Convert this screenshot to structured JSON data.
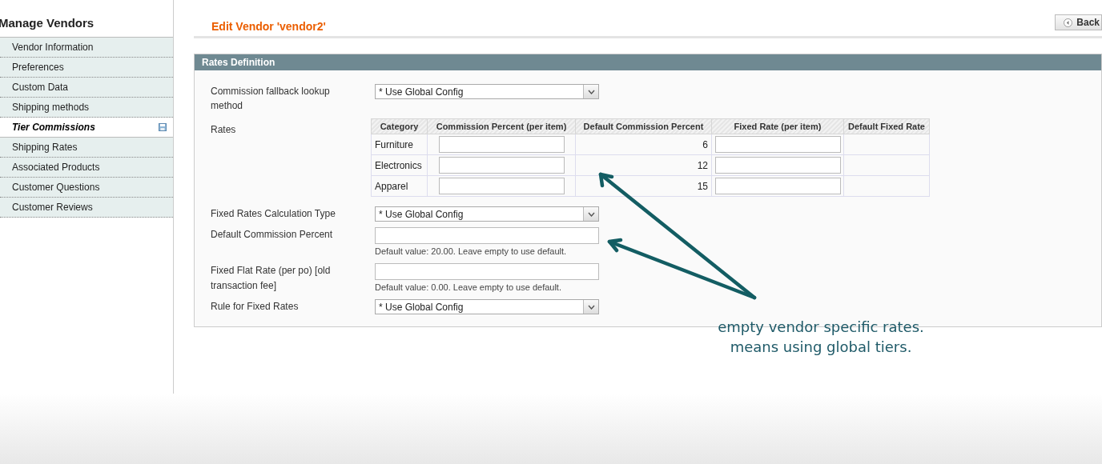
{
  "sidebar": {
    "title": "Manage Vendors",
    "items": [
      {
        "label": "Vendor Information",
        "selected": false,
        "changed": false
      },
      {
        "label": "Preferences",
        "selected": false,
        "changed": false
      },
      {
        "label": "Custom Data",
        "selected": false,
        "changed": false
      },
      {
        "label": "Shipping methods",
        "selected": false,
        "changed": false
      },
      {
        "label": "Tier Commissions",
        "selected": true,
        "changed": true
      },
      {
        "label": "Shipping Rates",
        "selected": false,
        "changed": false
      },
      {
        "label": "Associated Products",
        "selected": false,
        "changed": false
      },
      {
        "label": "Customer Questions",
        "selected": false,
        "changed": false
      },
      {
        "label": "Customer Reviews",
        "selected": false,
        "changed": false
      }
    ]
  },
  "page": {
    "title": "Edit Vendor 'vendor2'",
    "back_button": "Back"
  },
  "section": {
    "title": "Rates Definition",
    "fields": [
      {
        "kind": "select",
        "label": "Commission fallback lookup method",
        "value": "* Use Global Config"
      },
      {
        "kind": "table",
        "label": "Rates",
        "table": {
          "columns": [
            "Category",
            "Commission Percent (per item)",
            "Default Commission Percent",
            "Fixed Rate (per item)",
            "Default Fixed Rate"
          ],
          "rows": [
            {
              "category": "Furniture",
              "default_percent": "6"
            },
            {
              "category": "Electronics",
              "default_percent": "12"
            },
            {
              "category": "Apparel",
              "default_percent": "15"
            }
          ]
        }
      },
      {
        "kind": "select",
        "label": "Fixed Rates Calculation Type",
        "value": "* Use Global Config"
      },
      {
        "kind": "text",
        "label": "Default Commission Percent",
        "note": "Default value: 20.00. Leave empty to use default."
      },
      {
        "kind": "text",
        "label": "Fixed Flat Rate (per po) [old transaction fee]",
        "note": "Default value: 0.00. Leave empty to use default."
      },
      {
        "kind": "select",
        "label": "Rule for Fixed Rates",
        "value": "* Use Global Config"
      }
    ]
  },
  "annotation": {
    "lines": [
      "empty vendor specific rates.",
      "means using global tiers."
    ]
  }
}
